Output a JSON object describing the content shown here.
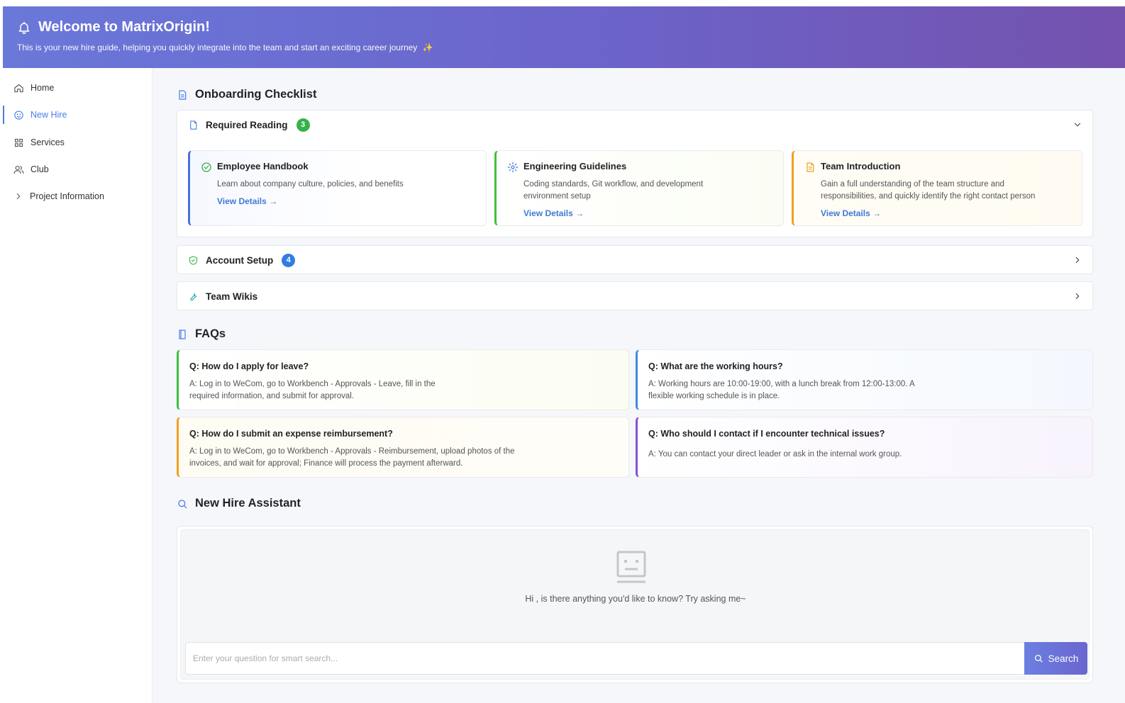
{
  "header": {
    "title": "Welcome to MatrixOrigin!",
    "subtitle": "This is your new hire guide, helping you quickly integrate into the team and start an exciting career journey",
    "sparkle": "✨",
    "icon": "bell-icon"
  },
  "sidebar": {
    "items": [
      {
        "label": "Home",
        "icon": "home-icon",
        "active": false
      },
      {
        "label": "New Hire",
        "icon": "smile-icon",
        "active": true
      },
      {
        "label": "Services",
        "icon": "grid-icon",
        "active": false
      },
      {
        "label": "Club",
        "icon": "users-icon",
        "active": false
      },
      {
        "label": "Project Information",
        "icon": "chevron-right-icon",
        "active": false
      }
    ]
  },
  "checklist": {
    "title": "Onboarding Checklist",
    "required_reading": {
      "label": "Required Reading",
      "count": "3",
      "cards": [
        {
          "title": "Employee Handbook",
          "desc": "Learn about company culture, policies, and benefits",
          "link": "View Details →",
          "accent": "#4a6fe0"
        },
        {
          "title": "Engineering Guidelines",
          "desc": "Coding standards, Git workflow, and development environment setup",
          "link": "View Details →",
          "accent": "#3fbf3f"
        },
        {
          "title": "Team Introduction",
          "desc": "Gain a full understanding of the team structure and responsibilities, and quickly identify the right contact person",
          "link": "View Details →",
          "accent": "#f0a020"
        }
      ]
    },
    "account_setup": {
      "label": "Account Setup",
      "count": "4"
    },
    "team_wikis": {
      "label": "Team Wikis"
    }
  },
  "faqs": {
    "title": "FAQs",
    "items": [
      {
        "q": "Q: How do I apply for leave?",
        "a": "A: Log in to WeCom, go to Workbench - Approvals - Leave, fill in the required information, and submit for approval.",
        "accent": "#3fbf3f"
      },
      {
        "q": "Q: What are the working hours?",
        "a": "A: Working hours are 10:00-19:00, with a lunch break from 12:00-13:00. A flexible working schedule is in place.",
        "accent": "#3f8be0"
      },
      {
        "q": "Q: How do I submit an expense reimbursement?",
        "a": "A: Log in to WeCom, go to Workbench - Approvals - Reimbursement, upload photos of the invoices, and wait for approval; Finance will process the payment afterward.",
        "accent": "#f0a020"
      },
      {
        "q": "Q: Who should I contact if I encounter technical issues?",
        "a": "A: You can contact your direct leader or ask in the internal work group.",
        "accent": "#8a4fd0"
      }
    ]
  },
  "assistant": {
    "title": "New Hire Assistant",
    "message": "Hi , is there anything you'd like to know? Try asking me~",
    "placeholder": "Enter your question for smart search...",
    "button": "Search"
  }
}
